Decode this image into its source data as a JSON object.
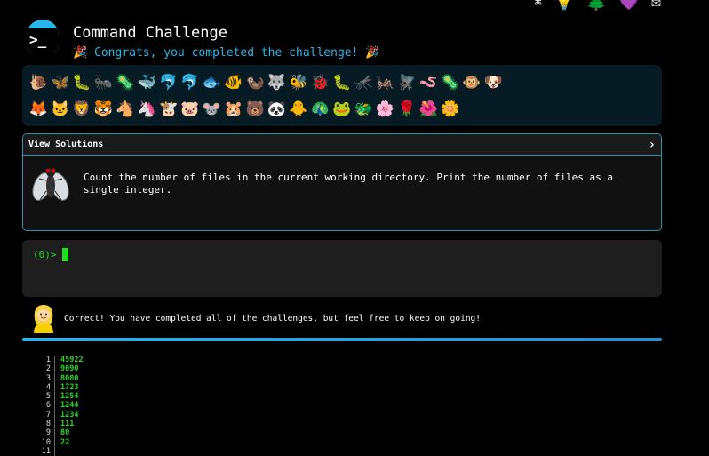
{
  "top_icons": [
    "⌘",
    "💡",
    "🌲",
    "💜",
    "✉"
  ],
  "header": {
    "logo_glyph": ">_",
    "title": "Command Challenge",
    "subtitle": "🎉 Congrats, you completed the challenge! 🎉"
  },
  "emoji_rows": [
    [
      "🐌",
      "🦋",
      "🐛",
      "🐜",
      "🦠",
      "🐳",
      "🐬",
      "🐬",
      "🐟",
      "🐠",
      "🦦",
      "🐺",
      "🐝",
      "🐞",
      "🐛",
      "🦟",
      "🦗",
      "🪰",
      "🪱",
      "🦠",
      "🐵",
      "🐶"
    ],
    [
      "🦊",
      "🐱",
      "🦁",
      "🐯",
      "🐴",
      "🦄",
      "🐮",
      "🐷",
      "🐭",
      "🐹",
      "🐻",
      "🐼",
      "🐥",
      "🦚",
      "🐸",
      "🐲",
      "🌸",
      "🌹",
      "🌺",
      "🌼"
    ]
  ],
  "solutions": {
    "label": "View Solutions",
    "chevron": "›",
    "task": "Count the number of files in the current working directory. Print the number of files as a single integer."
  },
  "terminal": {
    "prompt": "(0)>"
  },
  "message": {
    "text": "Correct! You have completed all of the challenges, but feel free to keep on going!"
  },
  "progress": {
    "fraction": 1.0
  },
  "output": {
    "line_numbers": [
      "1",
      "2",
      "3",
      "4",
      "5",
      "6",
      "7",
      "8",
      "9",
      "10",
      "11"
    ],
    "lines": [
      "45922",
      "9090",
      "8080",
      "1723",
      "1254",
      "1244",
      "1234",
      "111",
      "80",
      "22",
      ""
    ]
  },
  "colors": {
    "accent": "#29b6e8",
    "green": "#27d627"
  }
}
